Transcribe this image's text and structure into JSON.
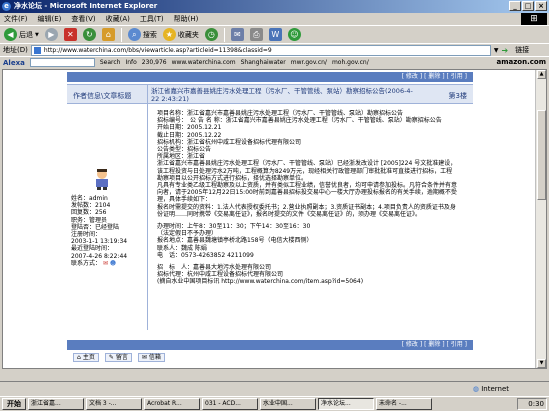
{
  "window": {
    "title": "净水论坛 - Microsoft Internet Explorer"
  },
  "menu": [
    "文件(F)",
    "编辑(E)",
    "查看(V)",
    "收藏(A)",
    "工具(T)",
    "帮助(H)"
  ],
  "toolbar": {
    "back": "后退",
    "search": "搜索",
    "favorites": "收藏夹"
  },
  "address": {
    "label": "地址(D)",
    "url": "http://www.waterchina.com/bbs/viewarticle.asp?articleid=11398&classid=9",
    "links": "链接"
  },
  "alexa": {
    "logo": "Alexa",
    "search_label": "Search",
    "info": "Info",
    "rank": "230,976",
    "links": [
      "www.waterchina.com",
      "Shanghaiwater",
      "mwr.gov.cn/",
      "moh.gov.cn/"
    ],
    "amazon": "amazon.com"
  },
  "post": {
    "top_actions": "[ 修改 ] [ 删除 ] [ 引用 ]",
    "header_left": "作者信息\\文章标题",
    "header_title": "浙江省嘉兴市嘉善县姚庄污水处理工程（污水厂、干管管线、泵站）勘察招标公告(2006-4-22 2:43:21)",
    "floor": "第3楼",
    "body": "项目名称：浙江省嘉兴市嘉善县姚庄污水处理工程（污水厂、干管管线、泵站）勘察招标公告\n招标编号：　公 告 名 称：浙江省嘉兴市嘉善县姚庄污水处理工程（污水厂、干管管线、泵站）勘察招标公告\n开始日期：2005.12.21\n截止日期：2005.12.22\n招标机构：浙江省杭州中咸工程设备招标代理有限公司\n公告类型：招标公告\n所属地区：浙江省\n浙江省嘉兴市嘉善县姚庄污水处理工程（污水厂、干管管线、泵站）已经浙发改设计 [2005]224 号文批准建设，该工程投资与日处理污水2万吨，工程概算为8249万元，现经相关行政管理部门审批批准可直接进行招标，工程勘察项目以公开招标方式进行招标，择优选择勘察单位。\n凡具有专业类乙级工程勘察及以上资质，并有类似工程业绩，信誉优良者，均可申请参加投标。凡符合条件并有意向者，请于2005年12月22日15:00时前到嘉善县招标投交易中心一楼大厅办理投标报名的有关手续，逾期概不受理，具体手续如下：\n报名时需提交的资料：1.法人代表授权委托书；2.营业执照副本；3.资质证书副本；4.项目负责人的资质证书及身份证明……同时携带《交易离任证》，报名时提交的文件《交易离任证》的，须办理《交易离任证》。",
    "contact": "办理时间：上午8：30至11：30；下午14：30至16：30\n（法定假日不予办理）\n报名地点：嘉善县魏塘镇亭桥北路158号（电信大楼西侧）\n联系人：魏成 陈娟\n电　话：0573-4263852 4211099",
    "footer": "招　标　人：嘉善县大地污水处理有限公司\n招标代理：杭州中咸工程设备招标代理有限公司\n(摘自水业中国项目标讯 http://www.waterchina.com/item.asp?id=5064)",
    "bottom_actions": "[ 修改 ] [ 删除 ] [ 引用 ]"
  },
  "author": {
    "name_label": "姓名：",
    "name": "admin",
    "posts_label": "发帖数：",
    "posts": "2104",
    "points_label": "回复数：",
    "points": "256",
    "level_label": "职务：",
    "level": "管理员",
    "state_label": "登陆否：",
    "state": "已经登陆",
    "reg_label": "注册时间：",
    "reg": "2003-1-1 13:19:34",
    "last_label": "最近登陆时间：",
    "last": "2007-4-26 8:22:44",
    "contact_label": "联系方式："
  },
  "bottom_icons": [
    "主页",
    "留言",
    "信箱"
  ],
  "status": {
    "text": "",
    "zone": "Internet"
  },
  "taskbar": {
    "start": "开始",
    "tasks": [
      "浙江省嘉...",
      "文档 3 -...",
      "Acrobat R...",
      "031 - ACD...",
      "水业中国...",
      "净水论坛...",
      "未命名 -..."
    ],
    "clock": "0:30"
  }
}
